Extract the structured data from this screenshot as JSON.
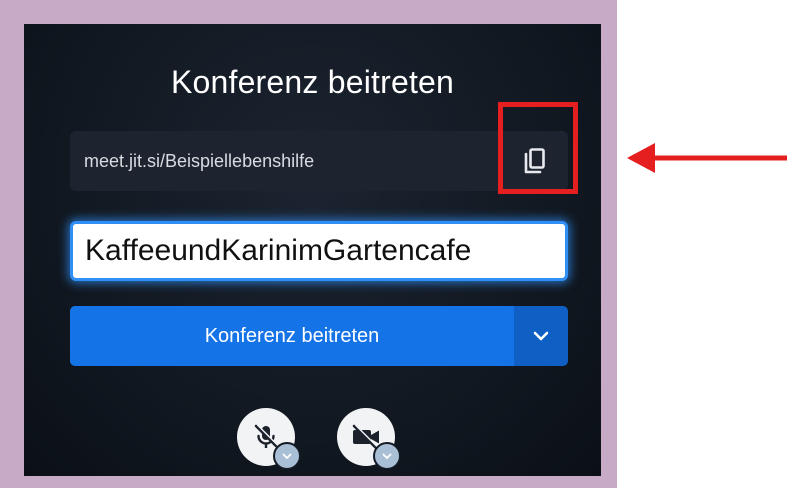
{
  "dialog": {
    "title": "Konferenz beitreten",
    "meeting_url": "meet.jit.si/Beispiellebenshilfe",
    "name_input_value": "KaffeeundKarinimGartencafe",
    "join_button_label": "Konferenz beitreten"
  },
  "icons": {
    "copy": "copy-icon",
    "dropdown": "chevron-down-icon",
    "microphone": "microphone-off-icon",
    "camera": "camera-off-icon"
  },
  "colors": {
    "frame": "#c7aac5",
    "panel": "#121922",
    "accent": "#1473e6",
    "input_glow": "#2f8ff6",
    "highlight": "#e51f1f"
  }
}
